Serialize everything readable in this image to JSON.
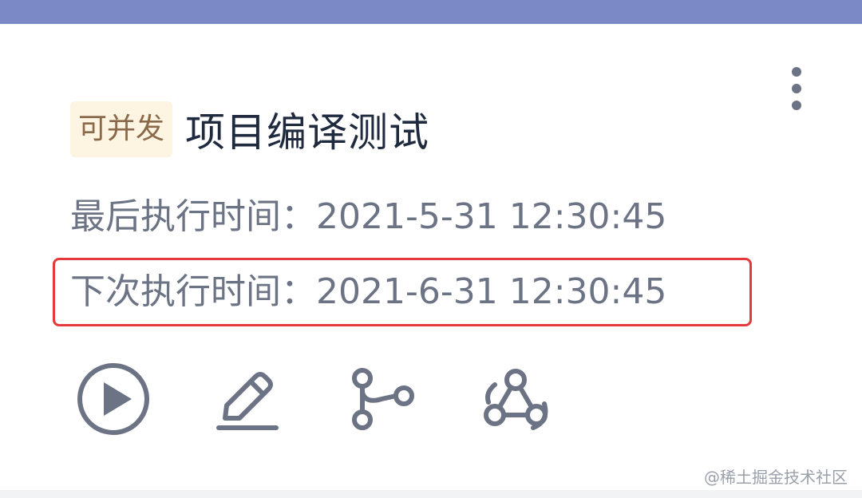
{
  "colors": {
    "top_bar": "#7b89c7",
    "text_primary": "#1f2a3f",
    "text_secondary": "#6b7384",
    "icon": "#6b7384",
    "badge_bg": "#fdf4e2",
    "badge_text": "#8a6a4a",
    "highlight_border": "#e5393b",
    "watermark": "#9aa0aa"
  },
  "card": {
    "badge": "可并发",
    "title": "项目编译测试",
    "more_icon": "more-vertical-icon",
    "last_run": {
      "label": "最后执行时间：",
      "value": "2021-5-31 12:30:45"
    },
    "next_run": {
      "label": "下次执行时间：",
      "value": "2021-6-31 12:30:45"
    },
    "actions": [
      {
        "icon": "play-icon"
      },
      {
        "icon": "edit-icon"
      },
      {
        "icon": "branch-icon"
      },
      {
        "icon": "webhook-icon"
      }
    ]
  },
  "watermark": "@稀土掘金技术社区"
}
